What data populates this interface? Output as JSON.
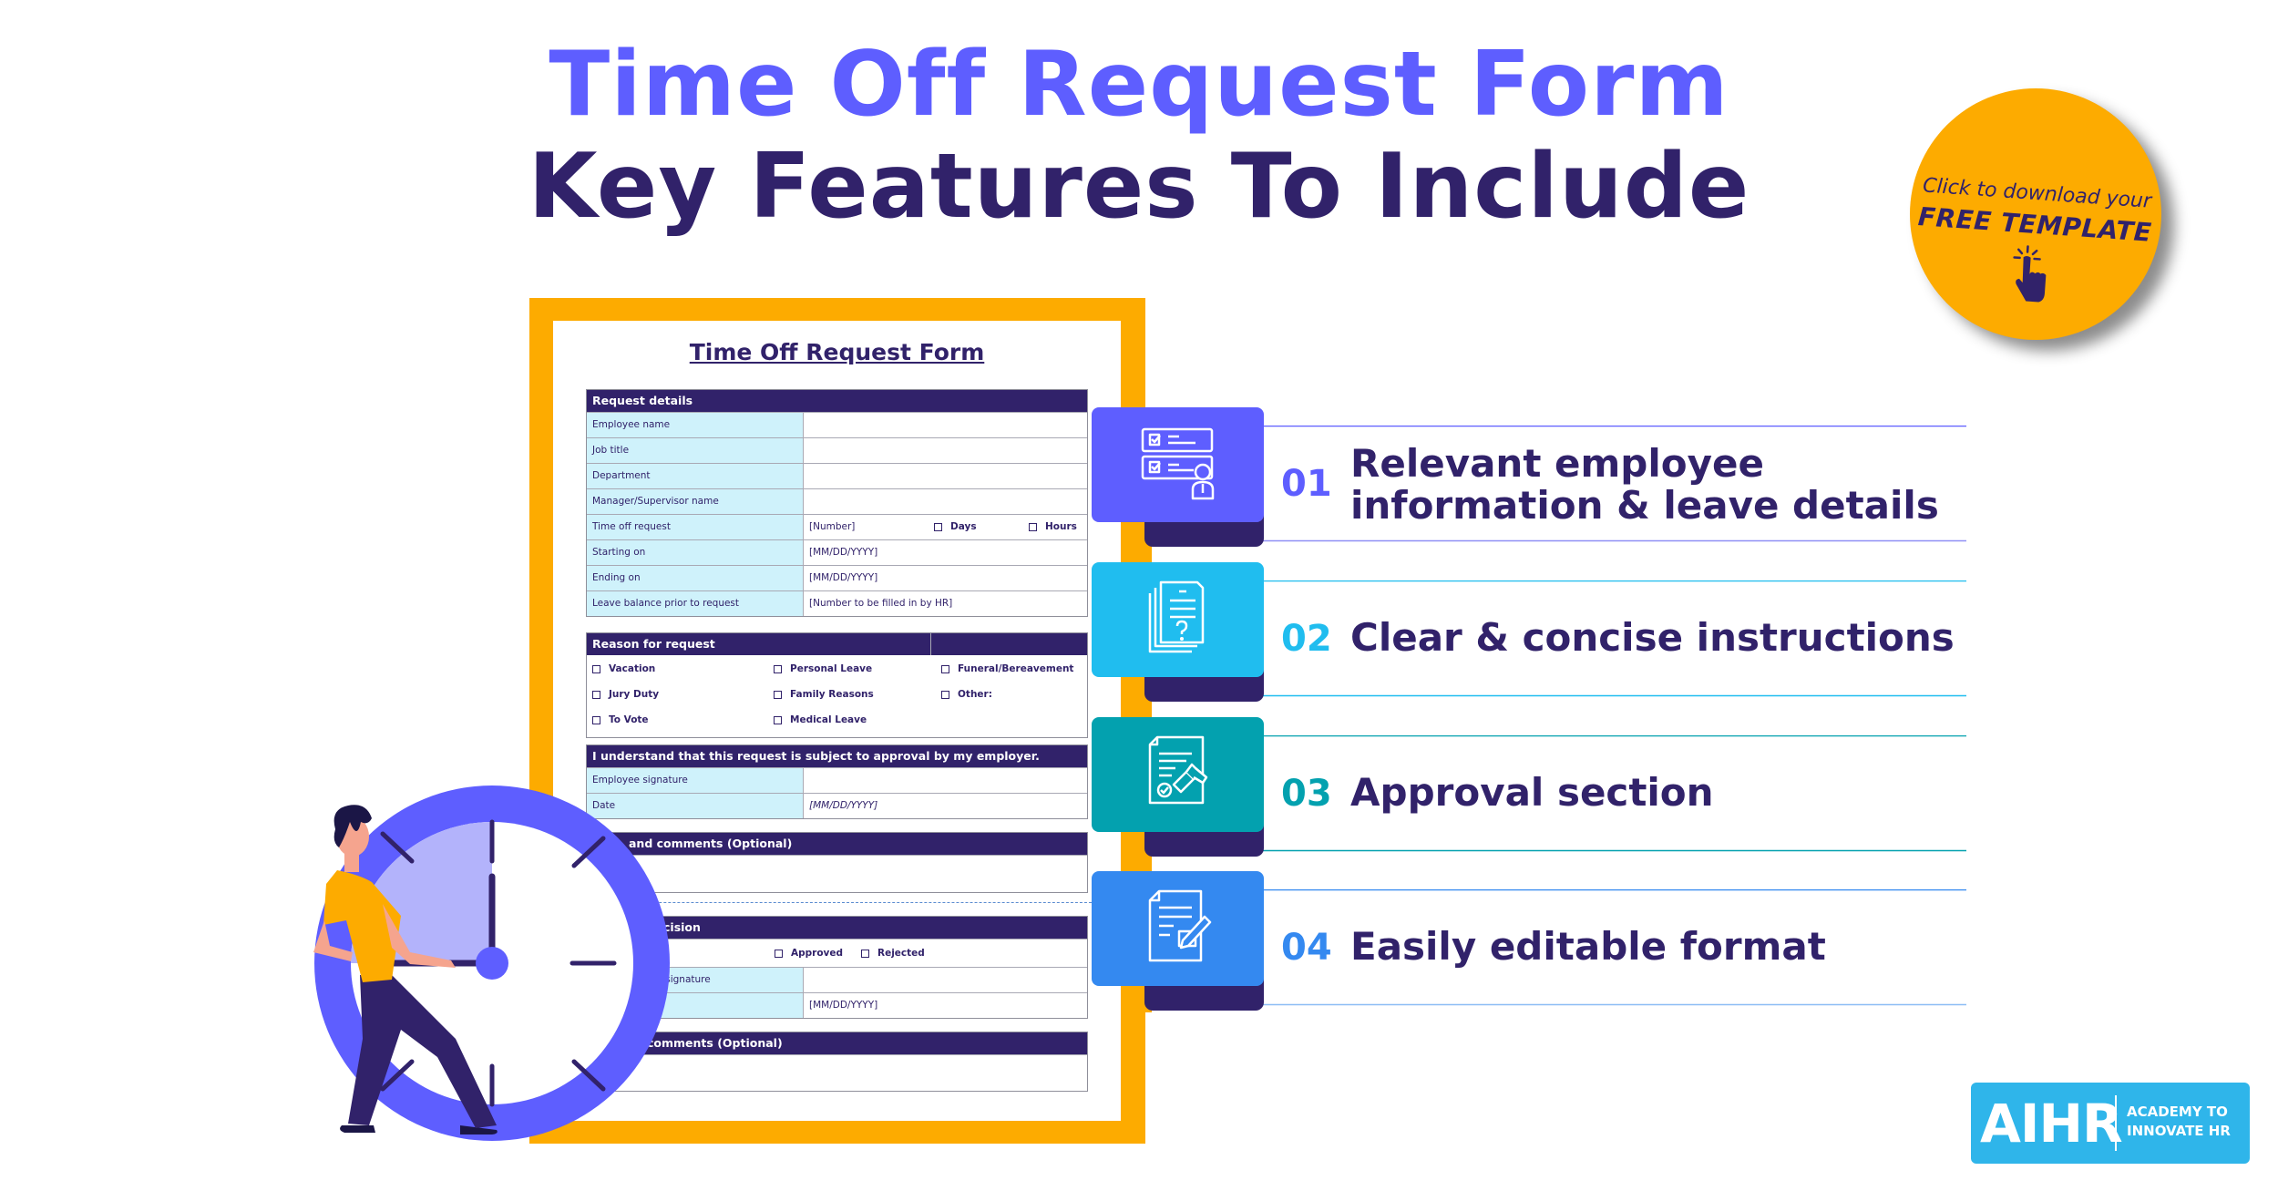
{
  "header": {
    "title_line1": "Time Off Request Form",
    "title_line2": "Key Features To Include",
    "colors": {
      "accent": "#5e5eff",
      "primary": "#31226a",
      "orange": "#fdab00"
    }
  },
  "download_badge": {
    "line1": "Click to download your",
    "line2": "FREE TEMPLATE",
    "icon": "pointer-hand-click-icon",
    "color": "#fdab00"
  },
  "form": {
    "title": "Time Off Request Form",
    "request_details": {
      "header": "Request details",
      "rows": [
        {
          "label": "Employee name",
          "value": ""
        },
        {
          "label": "Job title",
          "value": ""
        },
        {
          "label": "Department",
          "value": ""
        },
        {
          "label": "Manager/Supervisor name",
          "value": ""
        },
        {
          "label": "Time off request",
          "value": "[Number]",
          "option1": "Days",
          "option2": "Hours"
        },
        {
          "label": "Starting on",
          "value": "[MM/DD/YYYY]"
        },
        {
          "label": "Ending on",
          "value": "[MM/DD/YYYY]"
        },
        {
          "label": "Leave balance prior to request",
          "value": "[Number to be filled in by HR]"
        }
      ]
    },
    "reason": {
      "header": "Reason for request",
      "options": [
        "Vacation",
        "Personal Leave",
        "Funeral/Bereavement",
        "Jury Duty",
        "Family Reasons",
        "Other:",
        "To Vote",
        "Medical Leave",
        ""
      ]
    },
    "acknowledgement": {
      "header": "I understand that this request is subject to approval by my employer.",
      "rows": [
        {
          "label": "Employee signature",
          "value": ""
        },
        {
          "label": "Date",
          "value": "[MM/DD/YYYY]"
        }
      ]
    },
    "notes": {
      "header": "and comments (Optional)"
    },
    "decision": {
      "header": "cision",
      "approved": "Approved",
      "rejected": "Rejected",
      "rows": [
        {
          "label": "ntative signature",
          "value": ""
        },
        {
          "label": "",
          "value": "[MM/DD/YYYY]"
        }
      ]
    },
    "final_comments": {
      "header": "comments (Optional)"
    }
  },
  "features": [
    {
      "number": "01",
      "line1": "Relevant employee",
      "line2": "information & leave details",
      "color": "#5e5eff",
      "icon": "checklist-employee-icon"
    },
    {
      "number": "02",
      "line1": "Clear & concise instructions",
      "line2": "",
      "color": "#20bdef",
      "icon": "documents-question-icon"
    },
    {
      "number": "03",
      "line1": "Approval section",
      "line2": "",
      "color": "#03a1af",
      "icon": "document-stamp-approval-icon"
    },
    {
      "number": "04",
      "line1": "Easily editable format",
      "line2": "",
      "color": "#3489f0",
      "icon": "document-edit-pencil-icon"
    }
  ],
  "illustration": {
    "subject": "person-pulling-clock-hand"
  },
  "logo": {
    "mark": "AIHR",
    "line1": "ACADEMY TO",
    "line2": "INNOVATE HR",
    "color": "#2fb5ea"
  }
}
